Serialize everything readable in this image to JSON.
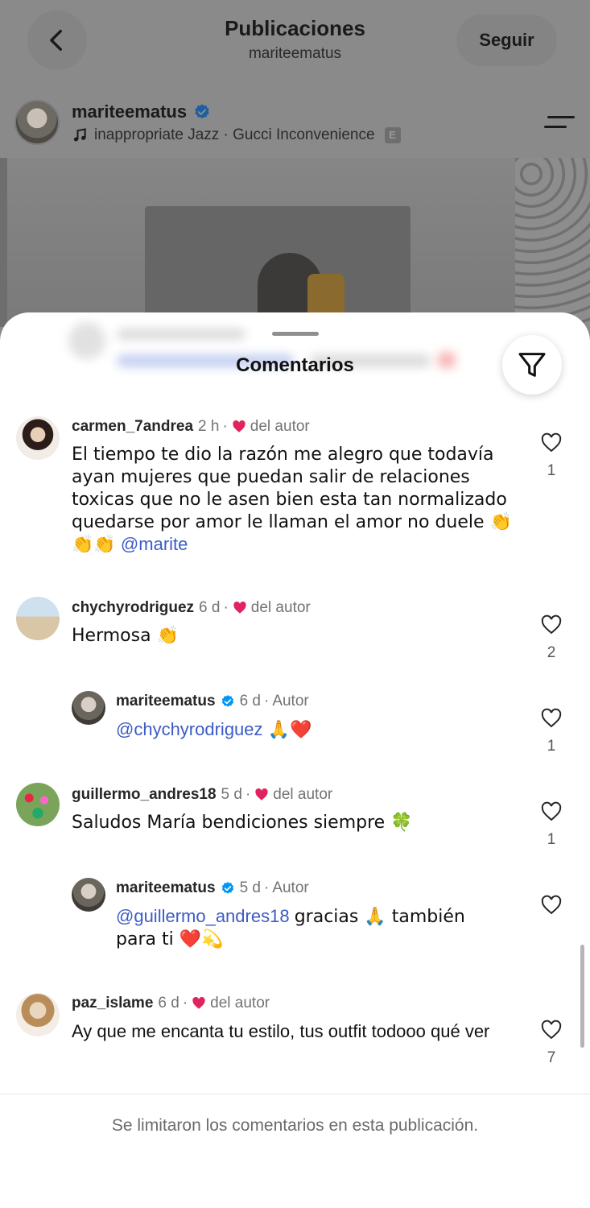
{
  "header": {
    "title": "Publicaciones",
    "subtitle": "mariteematus",
    "follow_label": "Seguir"
  },
  "post": {
    "username": "mariteematus",
    "music": "inappropriate Jazz · Gucci Inconvenience",
    "explicit_badge": "E"
  },
  "comments_sheet": {
    "title": "Comentarios",
    "footer_note": "Se limitaron los comentarios en esta publicación."
  },
  "comments": [
    {
      "username": "carmen_7andrea",
      "time": "2 h",
      "author_like": "del autor",
      "text": "El tiempo te dio la razón me alegro que todavía ayan mujeres que puedan salir de relaciones toxicas que no le asen bien esta tan normalizado quedarse por amor le llaman el amor no duele 👏👏👏",
      "mention": "@marite",
      "likes": "1"
    },
    {
      "username": "chychyrodriguez",
      "time": "6 d",
      "author_like": "del autor",
      "text": "Hermosa 👏",
      "likes": "2"
    },
    {
      "username": "mariteematus",
      "time": "6 d",
      "role": "Autor",
      "mention": "@chychyrodriguez",
      "text": "🙏❤️",
      "likes": "1"
    },
    {
      "username": "guillermo_andres18",
      "time": "5 d",
      "author_like": "del autor",
      "text": "Saludos María bendiciones siempre 🍀",
      "likes": "1"
    },
    {
      "username": "mariteematus",
      "time": "5 d",
      "role": "Autor",
      "mention": "@guillermo_andres18",
      "text_line1": "gracias 🙏 también",
      "text_line2": "para ti ❤️💫"
    },
    {
      "username": "paz_islame",
      "time": "6 d",
      "author_like": "del autor",
      "text": "Ay que me encanta tu estilo, tus outfit todooo qué ver",
      "likes": "7"
    }
  ],
  "colors": {
    "mention": "#3c5bc6",
    "heart": "#e0245e",
    "verified": "#0095f6",
    "dim_background": "#8a8a8a"
  },
  "icons": [
    "back-chevron-icon",
    "verified-badge-icon",
    "music-note-icon",
    "menu-lines-icon",
    "filter-icon",
    "heart-outline-icon",
    "heart-filled-icon"
  ]
}
